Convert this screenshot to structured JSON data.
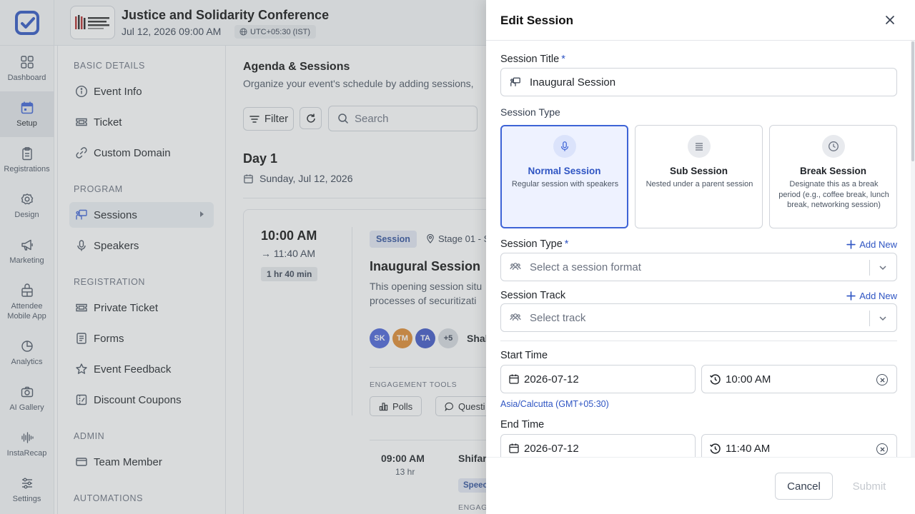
{
  "rail": {
    "items": [
      {
        "label": "Dashboard",
        "icon": "dashboard-icon"
      },
      {
        "label": "Setup",
        "icon": "calendar-icon"
      },
      {
        "label": "Registrations",
        "icon": "clipboard-icon"
      },
      {
        "label": "Design",
        "icon": "gear-icon"
      },
      {
        "label": "Marketing",
        "icon": "megaphone-icon"
      },
      {
        "label": "Attendee",
        "label2": "Mobile App",
        "icon": "app-icon"
      },
      {
        "label": "Analytics",
        "icon": "pie-chart-icon"
      },
      {
        "label": "AI Gallery",
        "icon": "camera-icon"
      },
      {
        "label": "InstaRecap",
        "icon": "waveform-icon"
      },
      {
        "label": "Settings",
        "icon": "sliders-icon"
      }
    ]
  },
  "header": {
    "event_title": "Justice and Solidarity Conference",
    "event_date": "Jul 12, 2026 09:00 AM",
    "timezone": "UTC+05:30 (IST)"
  },
  "nav": {
    "sections": [
      {
        "title": "BASIC DETAILS",
        "items": [
          "Event Info",
          "Ticket",
          "Custom Domain"
        ]
      },
      {
        "title": "PROGRAM",
        "items": [
          "Sessions",
          "Speakers"
        ]
      },
      {
        "title": "REGISTRATION",
        "items": [
          "Private Ticket",
          "Forms",
          "Event Feedback",
          "Discount Coupons"
        ]
      },
      {
        "title": "ADMIN",
        "items": [
          "Team Member"
        ]
      },
      {
        "title": "AUTOMATIONS",
        "items": []
      }
    ]
  },
  "main": {
    "title": "Agenda & Sessions",
    "subtitle": "Organize your event's schedule by adding sessions,",
    "filter_label": "Filter",
    "search_placeholder": "Search",
    "day_title": "Day 1",
    "day_date": "Sunday, Jul 12, 2026",
    "session": {
      "start": "10:00 AM",
      "end": "→ 11:40 AM",
      "duration": "1 hr 40 min",
      "badge": "Session",
      "stage": "Stage 01 - S",
      "name": "Inaugural Session",
      "desc_line1": "This opening session situ",
      "desc_line2": "processes of securitizati",
      "avatars": [
        {
          "initials": "SK",
          "color": "#4a63d8"
        },
        {
          "initials": "TM",
          "color": "#e08a2e"
        },
        {
          "initials": "TA",
          "color": "#3f57c7"
        }
      ],
      "more_count": "+5",
      "speaker_name": "Shal",
      "engagement_label": "ENGAGEMENT TOOLS",
      "polls_label": "Polls",
      "questions_label": "Questi"
    },
    "sub_session": {
      "time": "09:00 AM",
      "duration": "13 hr",
      "name": "Shifar",
      "badge": "Speec",
      "eng_label": "ENGAGE"
    }
  },
  "panel": {
    "title": "Edit Session",
    "title_label": "Session Title",
    "title_value": "Inaugural Session",
    "type_heading": "Session Type",
    "types": [
      {
        "name": "Normal Session",
        "desc": "Regular session with speakers"
      },
      {
        "name": "Sub Session",
        "desc": "Nested under a parent session"
      },
      {
        "name": "Break Session",
        "desc": "Designate this as a break period (e.g., coffee break, lunch break, networking session)"
      }
    ],
    "format_label": "Session Type",
    "format_placeholder": "Select a session format",
    "track_label": "Session Track",
    "track_placeholder": "Select track",
    "add_new": "Add New",
    "start_label": "Start Time",
    "start_date": "2026-07-12",
    "start_time": "10:00 AM",
    "timezone_link": "Asia/Calcutta (GMT+05:30)",
    "end_label": "End Time",
    "end_date": "2026-07-12",
    "end_time": "11:40 AM",
    "required_mark": "*",
    "cancel": "Cancel",
    "submit": "Submit"
  },
  "colors": {
    "accent": "#3d63d6",
    "accent_text": "#2f55c3",
    "badge_bg": "#e3e8f4"
  }
}
